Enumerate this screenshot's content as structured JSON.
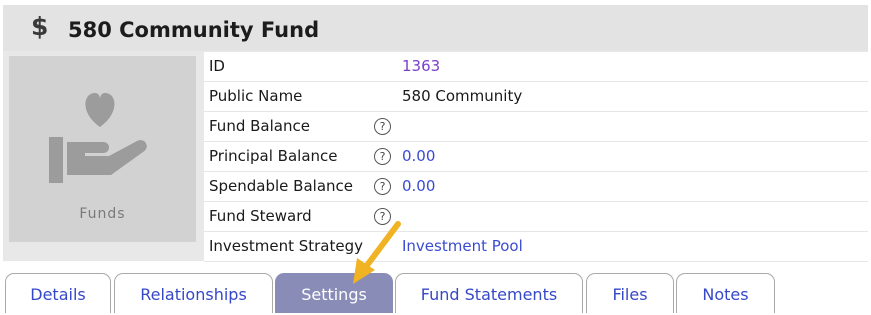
{
  "header": {
    "icon": "dollar-icon",
    "icon_glyph": "$",
    "title": "580 Community Fund"
  },
  "image": {
    "icon": "hand-heart-icon",
    "label": "Funds"
  },
  "fields": [
    {
      "label": "ID",
      "value": "1363",
      "help": false
    },
    {
      "label": "Public Name",
      "value": "580 Community",
      "help": false
    },
    {
      "label": "Fund Balance",
      "value": "",
      "help": true
    },
    {
      "label": "Principal Balance",
      "value": "0.00",
      "help": true
    },
    {
      "label": "Spendable Balance",
      "value": "0.00",
      "help": true
    },
    {
      "label": "Fund Steward",
      "value": "",
      "help": true
    },
    {
      "label": "Investment Strategy",
      "value": "Investment Pool",
      "help": false
    }
  ],
  "help_glyph": "?",
  "tabs": [
    "Details",
    "Relationships",
    "Settings",
    "Fund Statements",
    "Files",
    "Notes"
  ],
  "active_tab": "Settings",
  "colors": {
    "header_bg": "#e3e3e3",
    "link": "#3a4bd0",
    "id_value": "#7b3fc9",
    "active_tab_bg": "#8a8cb8",
    "arrow": "#f0b323"
  }
}
